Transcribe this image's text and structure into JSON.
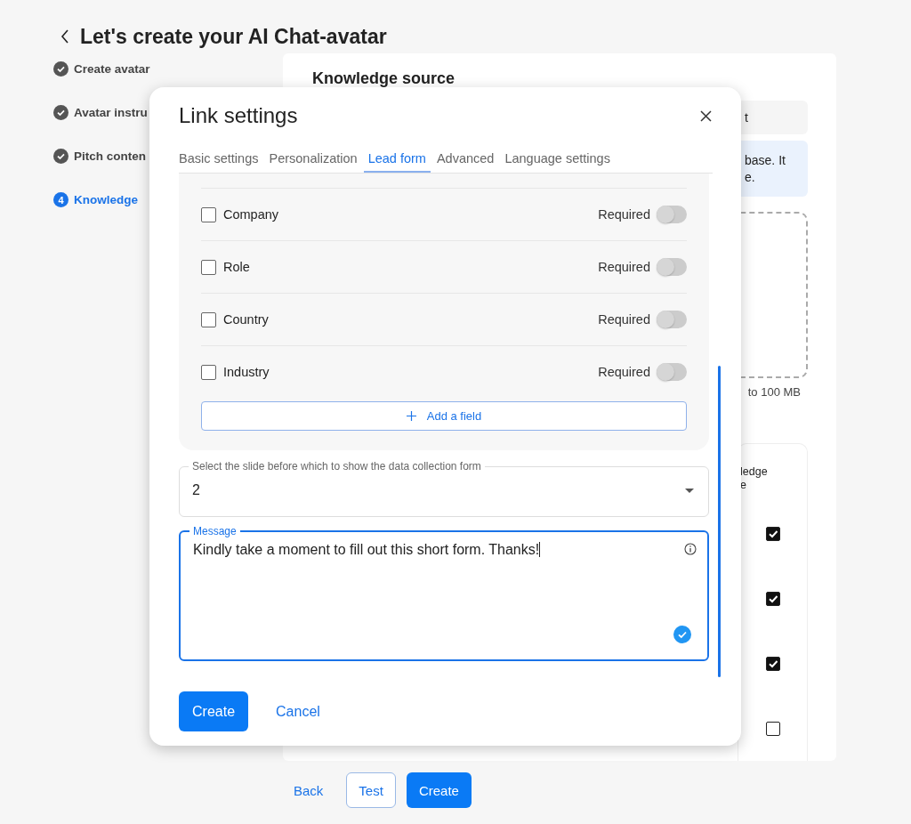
{
  "page": {
    "title": "Let's create your AI Chat-avatar"
  },
  "steps": [
    {
      "label": "Create avatar",
      "done": true,
      "selected": false
    },
    {
      "label": "Avatar instru",
      "done": true,
      "selected": false
    },
    {
      "label": "Pitch conten",
      "done": true,
      "selected": false
    },
    {
      "label": "Knowledge",
      "number": "4",
      "done": false,
      "selected": true
    }
  ],
  "knowledge_source": {
    "heading": "Knowledge source",
    "tab_fragment": "t",
    "info_lines": [
      "base. It",
      "e."
    ],
    "size_note": "to 100 MB",
    "table_header": [
      "ledge",
      "e"
    ],
    "rows": [
      {
        "checked": true
      },
      {
        "checked": true
      },
      {
        "checked": true
      },
      {
        "checked": false
      }
    ]
  },
  "footer_buttons": [
    {
      "label": "Back",
      "kind": "link"
    },
    {
      "label": "Test",
      "kind": "outline"
    },
    {
      "label": "Create",
      "kind": "primary"
    }
  ],
  "dialog": {
    "title": "Link settings",
    "tabs": [
      {
        "label": "Basic settings",
        "selected": false
      },
      {
        "label": "Personalization",
        "selected": false
      },
      {
        "label": "Lead form",
        "selected": true
      },
      {
        "label": "Advanced",
        "selected": false
      },
      {
        "label": "Language settings",
        "selected": false
      }
    ],
    "fields": [
      {
        "label": "Company",
        "checked": false,
        "required_label": "Required",
        "required": false
      },
      {
        "label": "Role",
        "checked": false,
        "required_label": "Required",
        "required": false
      },
      {
        "label": "Country",
        "checked": false,
        "required_label": "Required",
        "required": false
      },
      {
        "label": "Industry",
        "checked": false,
        "required_label": "Required",
        "required": false
      }
    ],
    "add_field": "Add a field",
    "slide_select": {
      "label": "Select the slide before which to show the data collection form",
      "value": "2"
    },
    "message": {
      "label": "Message",
      "value": "Kindly take a moment to fill out this short form. Thanks!"
    },
    "buttons": [
      {
        "label": "Create",
        "kind": "primary"
      },
      {
        "label": "Cancel",
        "kind": "link"
      }
    ]
  }
}
